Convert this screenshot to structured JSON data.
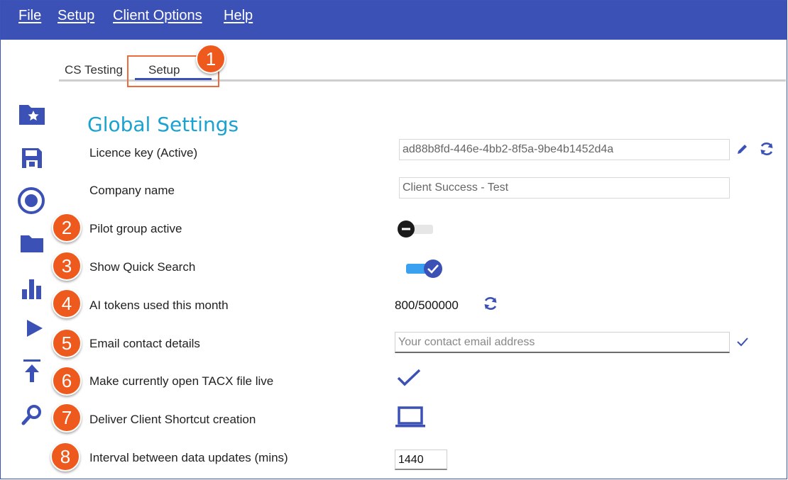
{
  "menu": {
    "file": "File",
    "setup": "Setup",
    "client_options": "Client Options",
    "help": "Help"
  },
  "tabs": [
    {
      "label": "CS Testing"
    },
    {
      "label": "Setup"
    }
  ],
  "badges": [
    "1",
    "2",
    "3",
    "4",
    "5",
    "6",
    "7",
    "8"
  ],
  "section_title": "Global Settings",
  "settings": {
    "licence_key": {
      "label": "Licence key (Active)",
      "value": "ad88b8fd-446e-4bb2-8f5a-9be4b1452d4a"
    },
    "company_name": {
      "label": "Company name",
      "value": "Client Success - Test"
    },
    "pilot_group": {
      "label": "Pilot group active",
      "state": "off"
    },
    "quick_search": {
      "label": "Show Quick Search",
      "state": "on"
    },
    "ai_tokens": {
      "label": "AI tokens used this month",
      "value": "800/500000"
    },
    "email": {
      "label": "Email contact details",
      "placeholder": "Your contact email address"
    },
    "make_live": {
      "label": "Make currently open TACX file live"
    },
    "shortcut": {
      "label": "Deliver Client Shortcut creation"
    },
    "interval": {
      "label": "Interval between data updates (mins)",
      "value": "1440"
    }
  },
  "sidebar_icons": [
    "folder-star-icon",
    "save-icon",
    "record-icon",
    "folder-icon",
    "bar-chart-icon",
    "play-icon",
    "upload-icon",
    "search-icon"
  ],
  "colors": {
    "menubar": "#3c51b5",
    "accent": "#3c51b5",
    "title": "#1aa3d0",
    "badge": "#ee5a1d",
    "highlight": "#ec6b3c",
    "toggle_on": "#3aa0f0"
  }
}
